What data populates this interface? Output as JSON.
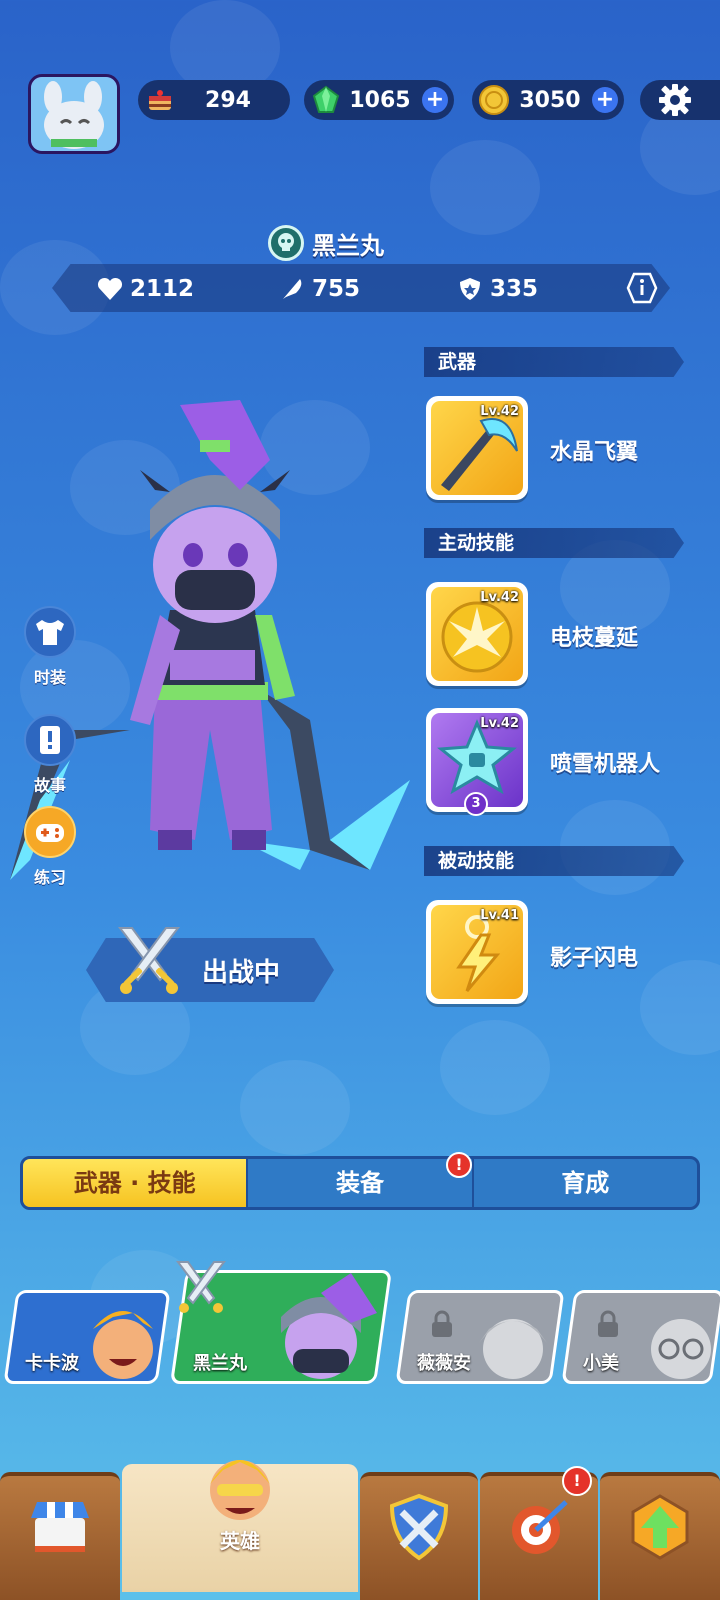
{
  "resources": {
    "cake": {
      "value": "294"
    },
    "gems": {
      "value": "1065"
    },
    "coins": {
      "value": "3050"
    }
  },
  "hero": {
    "name": "黑兰丸",
    "stats": {
      "hp": "2112",
      "attack": "755",
      "defense": "335"
    }
  },
  "sections": {
    "weapon": "武器",
    "active_skill": "主动技能",
    "passive_skill": "被动技能"
  },
  "skills": [
    {
      "level": "Lv.42",
      "name": "水晶飞翼",
      "icon": "crystal-scythe-icon"
    },
    {
      "level": "Lv.42",
      "name": "电枝蔓延",
      "icon": "lightning-burst-icon"
    },
    {
      "level": "Lv.42",
      "name": "喷雪机器人",
      "icon": "snow-robot-icon",
      "badge": "3"
    },
    {
      "level": "Lv.41",
      "name": "影子闪电",
      "icon": "shadow-lightning-icon"
    }
  ],
  "side_menu": {
    "fashion": "时装",
    "story": "故事",
    "practice": "练习"
  },
  "deploy_status": "出战中",
  "tabs": {
    "weapon_skill": "武器 · 技能",
    "equipment": "装备",
    "develop": "育成",
    "alert": "!"
  },
  "heroes": [
    {
      "name": "卡卡波",
      "locked": false
    },
    {
      "name": "黑兰丸",
      "locked": false,
      "selected": true
    },
    {
      "name": "薇薇安",
      "locked": true
    },
    {
      "name": "小美",
      "locked": true
    }
  ],
  "nav": {
    "hero_label": "英雄",
    "alert": "!"
  },
  "colors": {
    "active_tab": "#f6c321",
    "alert": "#e5332a",
    "panel": "#17326e"
  }
}
